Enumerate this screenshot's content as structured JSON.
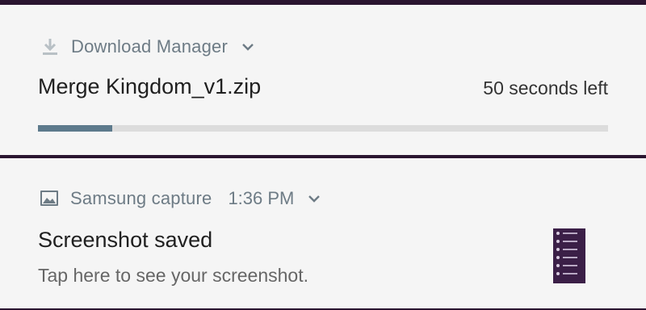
{
  "download_notification": {
    "app_name": "Download Manager",
    "app_icon": "download-icon",
    "expand_icon": "chevron-down-icon",
    "file_name": "Merge Kingdom_v1.zip",
    "time_left": "50 seconds left",
    "progress_fraction": 0.13,
    "progress_color": "#5d7a8c"
  },
  "capture_notification": {
    "app_name": "Samsung capture",
    "app_icon": "image-icon",
    "time": "1:36 PM",
    "expand_icon": "chevron-down-icon",
    "title": "Screenshot saved",
    "body": "Tap here to see your screenshot.",
    "thumbnail_icon": "screenshot-thumbnail"
  },
  "colors": {
    "background": "#2a1530",
    "card": "#f5f5f5",
    "secondary_text": "#6d7b85"
  }
}
